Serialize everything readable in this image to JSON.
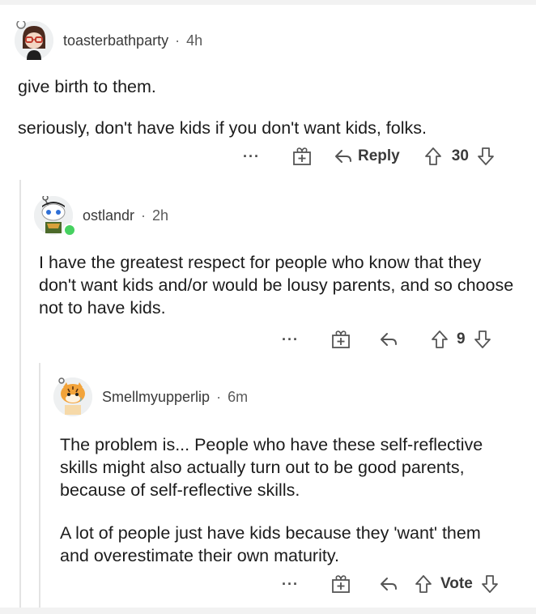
{
  "comments": [
    {
      "username": "toasterbathparty",
      "separator": "·",
      "time": "4h",
      "paragraphs": [
        "give birth to them.",
        "seriously, don't have kids if you don't want kids, folks."
      ],
      "actions": {
        "more": "···",
        "reply": "Reply",
        "votes": "30"
      },
      "avatar_icon": "snoo-avatar-girl-glasses"
    },
    {
      "username": "ostlandr",
      "separator": "·",
      "time": "2h",
      "paragraphs": [
        "I have the greatest respect for people who know that they don't want kids and/or would be lousy parents, and so choose not to have kids."
      ],
      "actions": {
        "more": "···",
        "votes": "9"
      },
      "avatar_icon": "snoo-avatar-online",
      "online": true
    },
    {
      "username": "Smellmyupperlip",
      "separator": "·",
      "time": "6m",
      "paragraphs": [
        "The problem is... People who have these self-reflective skills might also actually turn out to be good parents, because of self-reflective skills.",
        "A lot of people just have kids because they 'want' them and overestimate their own maturity."
      ],
      "actions": {
        "more": "···",
        "votes": "Vote"
      },
      "avatar_icon": "snoo-avatar-tiger"
    }
  ],
  "colors": {
    "online_dot": "#46d160",
    "thread_line": "#e3e3e3",
    "text": "#1c1c1c"
  }
}
